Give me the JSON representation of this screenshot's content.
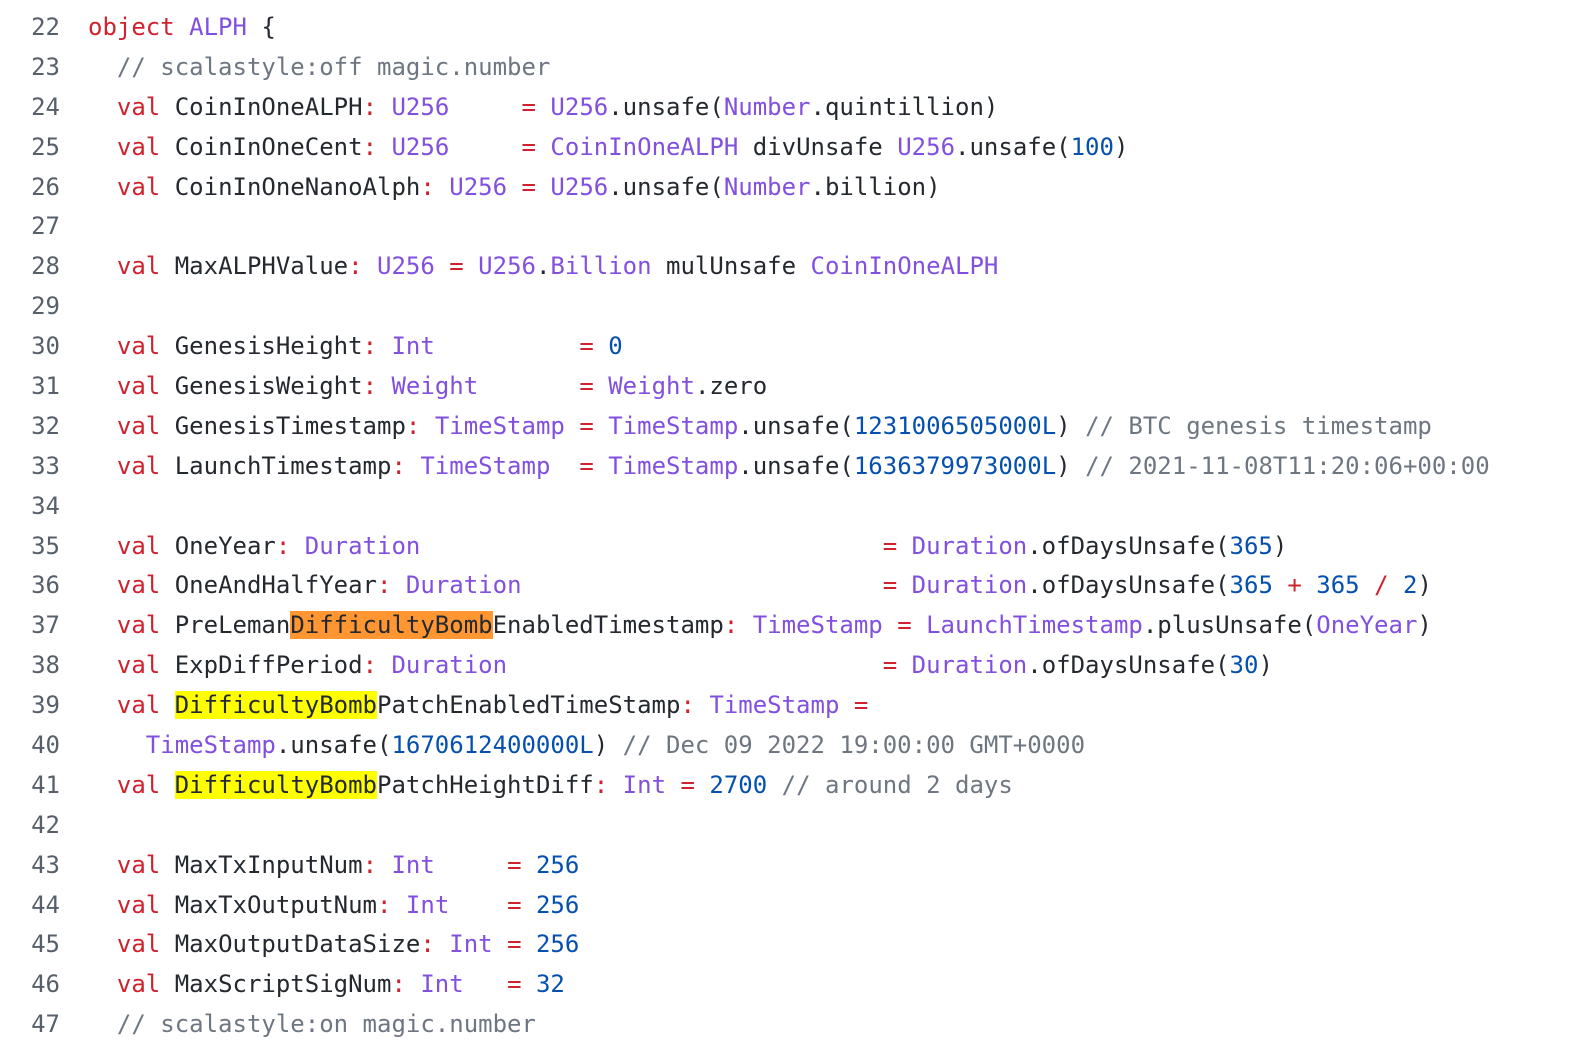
{
  "colors": {
    "keyword": "#cf222e",
    "type": "#8250df",
    "number": "#0550ae",
    "comment": "#6e7781",
    "text": "#24292f",
    "line_number": "#57606a",
    "highlight_current": "#ff9632",
    "highlight_match": "#ffff00"
  },
  "lines": [
    {
      "n": "22",
      "tokens": [
        [
          "kw",
          "object"
        ],
        [
          "tx",
          " "
        ],
        [
          "ty",
          "ALPH"
        ],
        [
          "tx",
          " {"
        ]
      ]
    },
    {
      "n": "23",
      "tokens": [
        [
          "tx",
          "  "
        ],
        [
          "cm",
          "// scalastyle:off magic.number"
        ]
      ]
    },
    {
      "n": "24",
      "tokens": [
        [
          "tx",
          "  "
        ],
        [
          "kw",
          "val"
        ],
        [
          "tx",
          " CoinInOneALPH"
        ],
        [
          "op",
          ":"
        ],
        [
          "tx",
          " "
        ],
        [
          "ty",
          "U256"
        ],
        [
          "tx",
          "     "
        ],
        [
          "op",
          "="
        ],
        [
          "tx",
          " "
        ],
        [
          "ty",
          "U256"
        ],
        [
          "tx",
          ".unsafe("
        ],
        [
          "ty",
          "Number"
        ],
        [
          "tx",
          ".quintillion)"
        ]
      ]
    },
    {
      "n": "25",
      "tokens": [
        [
          "tx",
          "  "
        ],
        [
          "kw",
          "val"
        ],
        [
          "tx",
          " CoinInOneCent"
        ],
        [
          "op",
          ":"
        ],
        [
          "tx",
          " "
        ],
        [
          "ty",
          "U256"
        ],
        [
          "tx",
          "     "
        ],
        [
          "op",
          "="
        ],
        [
          "tx",
          " "
        ],
        [
          "ty",
          "CoinInOneALPH"
        ],
        [
          "tx",
          " divUnsafe "
        ],
        [
          "ty",
          "U256"
        ],
        [
          "tx",
          ".unsafe("
        ],
        [
          "num",
          "100"
        ],
        [
          "tx",
          ")"
        ]
      ]
    },
    {
      "n": "26",
      "tokens": [
        [
          "tx",
          "  "
        ],
        [
          "kw",
          "val"
        ],
        [
          "tx",
          " CoinInOneNanoAlph"
        ],
        [
          "op",
          ":"
        ],
        [
          "tx",
          " "
        ],
        [
          "ty",
          "U256"
        ],
        [
          "tx",
          " "
        ],
        [
          "op",
          "="
        ],
        [
          "tx",
          " "
        ],
        [
          "ty",
          "U256"
        ],
        [
          "tx",
          ".unsafe("
        ],
        [
          "ty",
          "Number"
        ],
        [
          "tx",
          ".billion)"
        ]
      ]
    },
    {
      "n": "27",
      "tokens": []
    },
    {
      "n": "28",
      "tokens": [
        [
          "tx",
          "  "
        ],
        [
          "kw",
          "val"
        ],
        [
          "tx",
          " MaxALPHValue"
        ],
        [
          "op",
          ":"
        ],
        [
          "tx",
          " "
        ],
        [
          "ty",
          "U256"
        ],
        [
          "tx",
          " "
        ],
        [
          "op",
          "="
        ],
        [
          "tx",
          " "
        ],
        [
          "ty",
          "U256"
        ],
        [
          "tx",
          "."
        ],
        [
          "ty",
          "Billion"
        ],
        [
          "tx",
          " mulUnsafe "
        ],
        [
          "ty",
          "CoinInOneALPH"
        ]
      ]
    },
    {
      "n": "29",
      "tokens": []
    },
    {
      "n": "30",
      "tokens": [
        [
          "tx",
          "  "
        ],
        [
          "kw",
          "val"
        ],
        [
          "tx",
          " GenesisHeight"
        ],
        [
          "op",
          ":"
        ],
        [
          "tx",
          " "
        ],
        [
          "ty",
          "Int"
        ],
        [
          "tx",
          "          "
        ],
        [
          "op",
          "="
        ],
        [
          "tx",
          " "
        ],
        [
          "num",
          "0"
        ]
      ]
    },
    {
      "n": "31",
      "tokens": [
        [
          "tx",
          "  "
        ],
        [
          "kw",
          "val"
        ],
        [
          "tx",
          " GenesisWeight"
        ],
        [
          "op",
          ":"
        ],
        [
          "tx",
          " "
        ],
        [
          "ty",
          "Weight"
        ],
        [
          "tx",
          "       "
        ],
        [
          "op",
          "="
        ],
        [
          "tx",
          " "
        ],
        [
          "ty",
          "Weight"
        ],
        [
          "tx",
          ".zero"
        ]
      ]
    },
    {
      "n": "32",
      "tokens": [
        [
          "tx",
          "  "
        ],
        [
          "kw",
          "val"
        ],
        [
          "tx",
          " GenesisTimestamp"
        ],
        [
          "op",
          ":"
        ],
        [
          "tx",
          " "
        ],
        [
          "ty",
          "TimeStamp"
        ],
        [
          "tx",
          " "
        ],
        [
          "op",
          "="
        ],
        [
          "tx",
          " "
        ],
        [
          "ty",
          "TimeStamp"
        ],
        [
          "tx",
          ".unsafe("
        ],
        [
          "num",
          "1231006505000L"
        ],
        [
          "tx",
          ") "
        ],
        [
          "cm",
          "// BTC genesis timestamp"
        ]
      ]
    },
    {
      "n": "33",
      "tokens": [
        [
          "tx",
          "  "
        ],
        [
          "kw",
          "val"
        ],
        [
          "tx",
          " LaunchTimestamp"
        ],
        [
          "op",
          ":"
        ],
        [
          "tx",
          " "
        ],
        [
          "ty",
          "TimeStamp"
        ],
        [
          "tx",
          "  "
        ],
        [
          "op",
          "="
        ],
        [
          "tx",
          " "
        ],
        [
          "ty",
          "TimeStamp"
        ],
        [
          "tx",
          ".unsafe("
        ],
        [
          "num",
          "1636379973000L"
        ],
        [
          "tx",
          ") "
        ],
        [
          "cm",
          "// 2021-11-08T11:20:06+00:00"
        ]
      ]
    },
    {
      "n": "34",
      "tokens": []
    },
    {
      "n": "35",
      "tokens": [
        [
          "tx",
          "  "
        ],
        [
          "kw",
          "val"
        ],
        [
          "tx",
          " OneYear"
        ],
        [
          "op",
          ":"
        ],
        [
          "tx",
          " "
        ],
        [
          "ty",
          "Duration"
        ],
        [
          "tx",
          "                                "
        ],
        [
          "op",
          "="
        ],
        [
          "tx",
          " "
        ],
        [
          "ty",
          "Duration"
        ],
        [
          "tx",
          ".ofDaysUnsafe("
        ],
        [
          "num",
          "365"
        ],
        [
          "tx",
          ")"
        ]
      ]
    },
    {
      "n": "36",
      "tokens": [
        [
          "tx",
          "  "
        ],
        [
          "kw",
          "val"
        ],
        [
          "tx",
          " OneAndHalfYear"
        ],
        [
          "op",
          ":"
        ],
        [
          "tx",
          " "
        ],
        [
          "ty",
          "Duration"
        ],
        [
          "tx",
          "                         "
        ],
        [
          "op",
          "="
        ],
        [
          "tx",
          " "
        ],
        [
          "ty",
          "Duration"
        ],
        [
          "tx",
          ".ofDaysUnsafe("
        ],
        [
          "num",
          "365"
        ],
        [
          "tx",
          " "
        ],
        [
          "op",
          "+"
        ],
        [
          "tx",
          " "
        ],
        [
          "num",
          "365"
        ],
        [
          "tx",
          " "
        ],
        [
          "op",
          "/"
        ],
        [
          "tx",
          " "
        ],
        [
          "num",
          "2"
        ],
        [
          "tx",
          ")"
        ]
      ]
    },
    {
      "n": "37",
      "tokens": [
        [
          "tx",
          "  "
        ],
        [
          "kw",
          "val"
        ],
        [
          "tx",
          " PreLeman"
        ],
        [
          "hlo",
          "DifficultyBomb"
        ],
        [
          "tx",
          "EnabledTimestamp"
        ],
        [
          "op",
          ":"
        ],
        [
          "tx",
          " "
        ],
        [
          "ty",
          "TimeStamp"
        ],
        [
          "tx",
          " "
        ],
        [
          "op",
          "="
        ],
        [
          "tx",
          " "
        ],
        [
          "ty",
          "LaunchTimestamp"
        ],
        [
          "tx",
          ".plusUnsafe("
        ],
        [
          "ty",
          "OneYear"
        ],
        [
          "tx",
          ")"
        ]
      ]
    },
    {
      "n": "38",
      "tokens": [
        [
          "tx",
          "  "
        ],
        [
          "kw",
          "val"
        ],
        [
          "tx",
          " ExpDiffPeriod"
        ],
        [
          "op",
          ":"
        ],
        [
          "tx",
          " "
        ],
        [
          "ty",
          "Duration"
        ],
        [
          "tx",
          "                          "
        ],
        [
          "op",
          "="
        ],
        [
          "tx",
          " "
        ],
        [
          "ty",
          "Duration"
        ],
        [
          "tx",
          ".ofDaysUnsafe("
        ],
        [
          "num",
          "30"
        ],
        [
          "tx",
          ")"
        ]
      ]
    },
    {
      "n": "39",
      "tokens": [
        [
          "tx",
          "  "
        ],
        [
          "kw",
          "val"
        ],
        [
          "tx",
          " "
        ],
        [
          "hly",
          "DifficultyBomb"
        ],
        [
          "tx",
          "PatchEnabledTimeStamp"
        ],
        [
          "op",
          ":"
        ],
        [
          "tx",
          " "
        ],
        [
          "ty",
          "TimeStamp"
        ],
        [
          "tx",
          " "
        ],
        [
          "op",
          "="
        ]
      ]
    },
    {
      "n": "40",
      "tokens": [
        [
          "tx",
          "    "
        ],
        [
          "ty",
          "TimeStamp"
        ],
        [
          "tx",
          ".unsafe("
        ],
        [
          "num",
          "1670612400000L"
        ],
        [
          "tx",
          ") "
        ],
        [
          "cm",
          "// Dec 09 2022 19:00:00 GMT+0000"
        ]
      ]
    },
    {
      "n": "41",
      "tokens": [
        [
          "tx",
          "  "
        ],
        [
          "kw",
          "val"
        ],
        [
          "tx",
          " "
        ],
        [
          "hly",
          "DifficultyBomb"
        ],
        [
          "tx",
          "PatchHeightDiff"
        ],
        [
          "op",
          ":"
        ],
        [
          "tx",
          " "
        ],
        [
          "ty",
          "Int"
        ],
        [
          "tx",
          " "
        ],
        [
          "op",
          "="
        ],
        [
          "tx",
          " "
        ],
        [
          "num",
          "2700"
        ],
        [
          "tx",
          " "
        ],
        [
          "cm",
          "// around 2 days"
        ]
      ]
    },
    {
      "n": "42",
      "tokens": []
    },
    {
      "n": "43",
      "tokens": [
        [
          "tx",
          "  "
        ],
        [
          "kw",
          "val"
        ],
        [
          "tx",
          " MaxTxInputNum"
        ],
        [
          "op",
          ":"
        ],
        [
          "tx",
          " "
        ],
        [
          "ty",
          "Int"
        ],
        [
          "tx",
          "     "
        ],
        [
          "op",
          "="
        ],
        [
          "tx",
          " "
        ],
        [
          "num",
          "256"
        ]
      ]
    },
    {
      "n": "44",
      "tokens": [
        [
          "tx",
          "  "
        ],
        [
          "kw",
          "val"
        ],
        [
          "tx",
          " MaxTxOutputNum"
        ],
        [
          "op",
          ":"
        ],
        [
          "tx",
          " "
        ],
        [
          "ty",
          "Int"
        ],
        [
          "tx",
          "    "
        ],
        [
          "op",
          "="
        ],
        [
          "tx",
          " "
        ],
        [
          "num",
          "256"
        ]
      ]
    },
    {
      "n": "45",
      "tokens": [
        [
          "tx",
          "  "
        ],
        [
          "kw",
          "val"
        ],
        [
          "tx",
          " MaxOutputDataSize"
        ],
        [
          "op",
          ":"
        ],
        [
          "tx",
          " "
        ],
        [
          "ty",
          "Int"
        ],
        [
          "tx",
          " "
        ],
        [
          "op",
          "="
        ],
        [
          "tx",
          " "
        ],
        [
          "num",
          "256"
        ]
      ]
    },
    {
      "n": "46",
      "tokens": [
        [
          "tx",
          "  "
        ],
        [
          "kw",
          "val"
        ],
        [
          "tx",
          " MaxScriptSigNum"
        ],
        [
          "op",
          ":"
        ],
        [
          "tx",
          " "
        ],
        [
          "ty",
          "Int"
        ],
        [
          "tx",
          "   "
        ],
        [
          "op",
          "="
        ],
        [
          "tx",
          " "
        ],
        [
          "num",
          "32"
        ]
      ]
    },
    {
      "n": "47",
      "tokens": [
        [
          "tx",
          "  "
        ],
        [
          "cm",
          "// scalastyle:on magic.number"
        ]
      ]
    }
  ]
}
